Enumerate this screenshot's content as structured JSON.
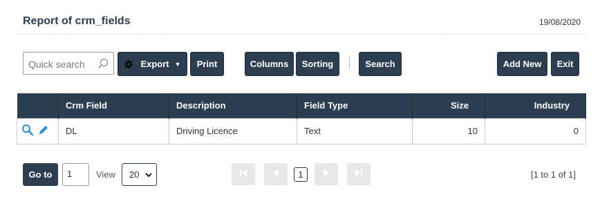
{
  "header": {
    "title": "Report of crm_fields",
    "date": "19/08/2020"
  },
  "toolbar": {
    "search_placeholder": "Quick search",
    "export_label": "Export",
    "print_label": "Print",
    "columns_label": "Columns",
    "sorting_label": "Sorting",
    "search_label": "Search",
    "add_new_label": "Add New",
    "exit_label": "Exit"
  },
  "table": {
    "columns": [
      "Crm Field",
      "Description",
      "Field Type",
      "Size",
      "Industry"
    ],
    "rows": [
      {
        "crm_field": "DL",
        "description": "Driving Licence",
        "field_type": "Text",
        "size": "10",
        "industry": "0"
      }
    ]
  },
  "pagination": {
    "goto_label": "Go to",
    "page_value": "1",
    "view_label": "View",
    "per_page": "20",
    "current_page": "1",
    "range_text": "[1 to 1 of 1]"
  },
  "colors": {
    "primary": "#2d3e50",
    "pager_disabled": "#e7e7e7"
  }
}
